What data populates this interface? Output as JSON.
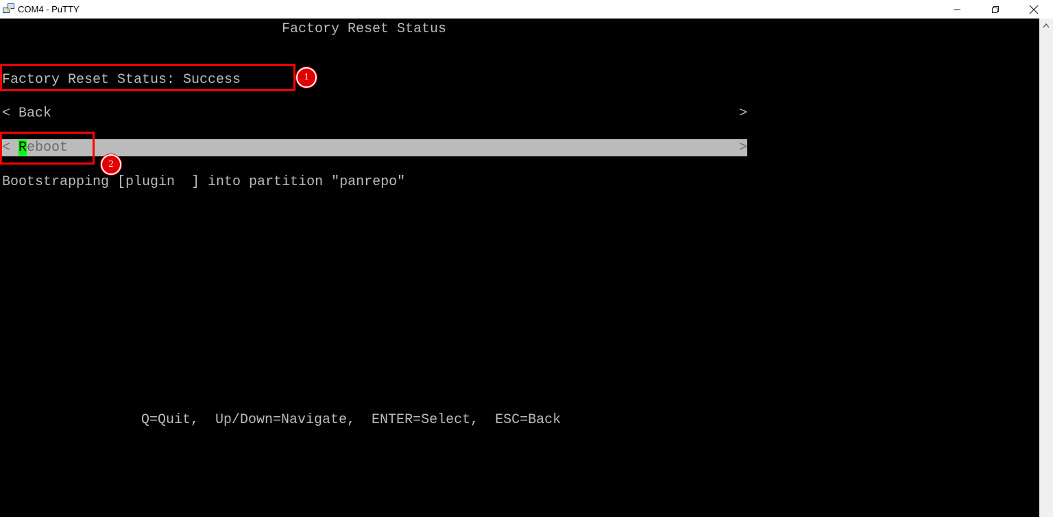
{
  "window": {
    "title": "COM4 - PuTTY",
    "controls": [
      "minimize",
      "restore",
      "close"
    ]
  },
  "terminal": {
    "heading": "Factory Reset Status",
    "status_line": "Factory Reset Status: Success",
    "menu": [
      {
        "label": "< Back",
        "arrow": ">",
        "selected": false
      },
      {
        "label_first": "< ",
        "label_cursor": "R",
        "label_rest": "eboot",
        "arrow": ">",
        "selected": true
      }
    ],
    "log_line": "Bootstrapping [plugin  ] into partition \"panrepo\"",
    "help_line": "Q=Quit,  Up/Down=Navigate,  ENTER=Select,  ESC=Back"
  },
  "annotations": [
    {
      "number": "1",
      "color": "#ff0000"
    },
    {
      "number": "2",
      "color": "#ff0000"
    }
  ],
  "colors": {
    "terminal_bg": "#000000",
    "terminal_fg": "#bbbbbb",
    "selection_bg": "#bbbbbb",
    "cursor": "#00ff00",
    "annotation": "#ff0000"
  }
}
